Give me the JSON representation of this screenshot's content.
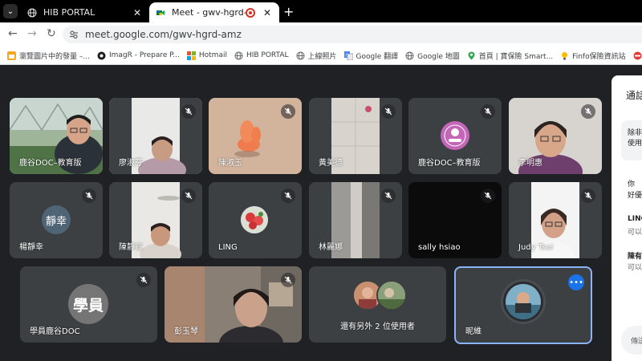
{
  "browser": {
    "tabs": [
      {
        "title": "HIB PORTAL",
        "icon": "globe-icon",
        "active": false
      },
      {
        "title": "Meet - gwv-hgrd-amz",
        "icon": "google-meet-icon",
        "active": true
      }
    ],
    "new_tab_label": "+",
    "url": "meet.google.com/gwv-hgrd-amz",
    "bookmarks": [
      {
        "label": "瀏覽圖片中的發量 –...",
        "icon": "bookmark-icon"
      },
      {
        "label": "ImagR - Prepare P...",
        "icon": "imagr-icon"
      },
      {
        "label": "Hotmail",
        "icon": "microsoft-icon"
      },
      {
        "label": "HIB PORTAL",
        "icon": "globe-icon"
      },
      {
        "label": "上線照片",
        "icon": "globe-icon"
      },
      {
        "label": "Google 翻譯",
        "icon": "google-translate-icon"
      },
      {
        "label": "Google 地圖",
        "icon": "google-maps-icon"
      },
      {
        "label": "首頁 | 寶保險 Smart...",
        "icon": "lightbulb-icon"
      },
      {
        "label": "Finfo保險資訊站",
        "icon": "finfo-icon"
      },
      {
        "label": "保",
        "icon": "folder-icon"
      }
    ]
  },
  "participants_row1": [
    {
      "name": "鹿谷DOC–教育版",
      "muted": false,
      "kind": "video-man-greenhouse"
    },
    {
      "name": "廖淑芬",
      "muted": true,
      "kind": "video-woman-door"
    },
    {
      "name": "陳淑玉",
      "muted": true,
      "kind": "video-orange-object"
    },
    {
      "name": "黃美德",
      "muted": true,
      "kind": "video-ceiling"
    },
    {
      "name": "鹿谷DOC–教育版",
      "muted": true,
      "kind": "avatar-logo"
    },
    {
      "name": "李明惠",
      "muted": true,
      "kind": "video-woman-glasses"
    }
  ],
  "participants_row2": [
    {
      "name": "楊靜幸",
      "muted": true,
      "kind": "avatar-text",
      "avatar_text": "靜幸"
    },
    {
      "name": "陳靜宜",
      "muted": true,
      "kind": "video-woman-fan"
    },
    {
      "name": "LING",
      "muted": true,
      "kind": "avatar-flowers"
    },
    {
      "name": "林麗娜",
      "muted": true,
      "kind": "video-wall"
    },
    {
      "name": "sally hsiao",
      "muted": true,
      "kind": "video-dark"
    },
    {
      "name": "Judy Tsai",
      "muted": true,
      "kind": "video-woman-white"
    }
  ],
  "participants_row3": [
    {
      "name": "學員鹿谷DOC",
      "muted": true,
      "kind": "avatar-text",
      "avatar_text": "學員"
    },
    {
      "name": "彭玉琴",
      "muted": true,
      "kind": "video-woman-room"
    },
    {
      "name": "還有另外 2 位使用者",
      "muted": false,
      "kind": "others"
    },
    {
      "name": "昵維",
      "muted": false,
      "kind": "self-avatar"
    }
  ],
  "side_panel": {
    "title": "通話",
    "lines": [
      "除非",
      "使用",
      "你",
      "好優",
      "LING",
      "可以",
      "陳有",
      "可以",
      "傳送"
    ]
  },
  "colors": {
    "meet_bg": "#202124",
    "tile_bg": "#3c4043",
    "highlight": "#8ab4f8",
    "accent": "#1a73e8"
  }
}
